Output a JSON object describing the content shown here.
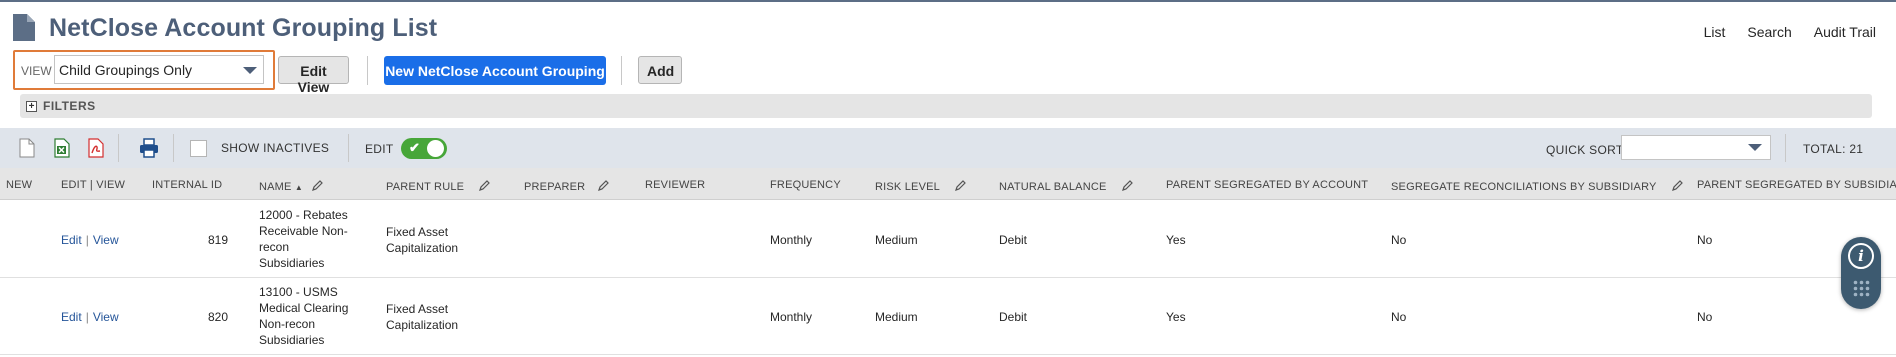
{
  "header": {
    "title": "NetClose Account Grouping List",
    "links": [
      "List",
      "Search",
      "Audit Trail"
    ]
  },
  "toolbar": {
    "view_label": "VIEW",
    "view_value": "Child Groupings Only",
    "edit_view": "Edit View",
    "new_button": "New NetClose Account Grouping",
    "add": "Add"
  },
  "filters": {
    "label": "FILTERS",
    "toggle": "+"
  },
  "list_toolbar": {
    "show_inactives": "SHOW INACTIVES",
    "edit": "EDIT",
    "quick_sort": "QUICK SORT",
    "total": "TOTAL: 21"
  },
  "table": {
    "columns": [
      "NEW",
      "EDIT | VIEW",
      "INTERNAL ID",
      "NAME",
      "PARENT RULE",
      "PREPARER",
      "REVIEWER",
      "FREQUENCY",
      "RISK LEVEL",
      "NATURAL BALANCE",
      "PARENT SEGREGATED BY ACCOUNT",
      "SEGREGATE RECONCILIATIONS BY SUBSIDIARY",
      "PARENT SEGREGATED BY SUBSIDIARY"
    ],
    "sort_indicator": "▲",
    "edit_label": "Edit",
    "view_label": "View",
    "separator": "|",
    "rows": [
      {
        "internal_id": "819",
        "name_lines": [
          "12000 - Rebates",
          "Receivable Non-",
          "recon",
          "Subsidiaries"
        ],
        "parent_rule_lines": [
          "Fixed Asset",
          "Capitalization"
        ],
        "frequency": "Monthly",
        "risk_level": "Medium",
        "natural_balance": "Debit",
        "parent_seg_account": "Yes",
        "seg_recon_subsidiary": "No",
        "parent_seg_subsidiary": "No"
      },
      {
        "internal_id": "820",
        "name_lines": [
          "13100 - USMS",
          "Medical Clearing",
          "Non-recon",
          "Subsidiaries"
        ],
        "parent_rule_lines": [
          "Fixed Asset",
          "Capitalization"
        ],
        "frequency": "Monthly",
        "risk_level": "Medium",
        "natural_balance": "Debit",
        "parent_seg_account": "Yes",
        "seg_recon_subsidiary": "No",
        "parent_seg_subsidiary": "No"
      }
    ]
  },
  "widget": {
    "info_glyph": "i"
  },
  "icons": [
    "document-icon",
    "new-page-icon",
    "export-excel-icon",
    "export-pdf-icon",
    "print-icon",
    "pencil-icon",
    "info-icon",
    "grid-dots-icon"
  ],
  "colors": {
    "title": "#4d5f79",
    "primary_button": "#1a6ee8",
    "toggle_on": "#47a639",
    "highlight_border": "#e07b39",
    "link": "#255599"
  }
}
